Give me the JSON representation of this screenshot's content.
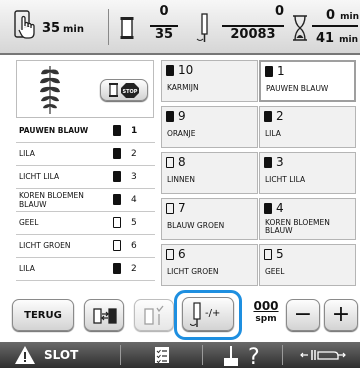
{
  "status_bar": {
    "time_value": "35",
    "time_unit": "min",
    "color_step_top": "0",
    "color_step_total": "35",
    "stitch_count_top": "0",
    "stitch_count_total": "20083",
    "remaining_time_top": "0",
    "remaining_time_top_unit": "min",
    "remaining_time_total": "41",
    "remaining_time_total_unit": "min"
  },
  "thread_list": [
    {
      "label": "PAUWEN BLAUW",
      "spool": "full",
      "number": "1",
      "selected": true
    },
    {
      "label": "LILA",
      "spool": "full",
      "number": "2"
    },
    {
      "label": "LICHT LILA",
      "spool": "full",
      "number": "3"
    },
    {
      "label": "KOREN BLOEMEN BLAUW",
      "spool": "full",
      "number": "4"
    },
    {
      "label": "GEEL",
      "spool": "empty",
      "number": "5"
    },
    {
      "label": "LICHT GROEN",
      "spool": "empty",
      "number": "6"
    },
    {
      "label": "LILA",
      "spool": "full",
      "number": "2"
    }
  ],
  "needle_grid": [
    {
      "number": "10",
      "label": "KARMIJN",
      "spool": "full"
    },
    {
      "number": "1",
      "label": "PAUWEN BLAUW",
      "spool": "full",
      "selected": true
    },
    {
      "number": "9",
      "label": "ORANJE",
      "spool": "full"
    },
    {
      "number": "2",
      "label": "LILA",
      "spool": "full"
    },
    {
      "number": "8",
      "label": "LINNEN",
      "spool": "empty"
    },
    {
      "number": "3",
      "label": "LICHT LILA",
      "spool": "full"
    },
    {
      "number": "7",
      "label": "BLAUW GROEN",
      "spool": "empty"
    },
    {
      "number": "4",
      "label": "KOREN BLOEMEN BLAUW",
      "spool": "full"
    },
    {
      "number": "6",
      "label": "LICHT GROEN",
      "spool": "empty"
    },
    {
      "number": "5",
      "label": "GEEL",
      "spool": "empty"
    }
  ],
  "toolbar": {
    "back_label": "TERUG",
    "needle_toggle_label": "-/+",
    "speed_value": "000",
    "speed_unit": "spm",
    "minus_label": "−",
    "plus_label": "+"
  },
  "footer": {
    "lock_label": "SLOT"
  },
  "colors": {
    "highlight_ring": "#1e8fe0",
    "footer_bg": "#3a3a3a"
  }
}
